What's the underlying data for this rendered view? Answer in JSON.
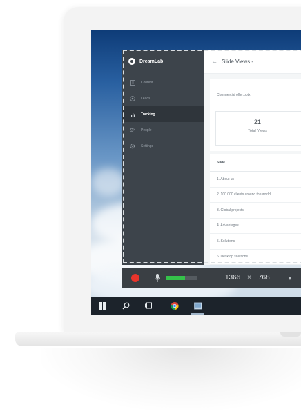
{
  "app": {
    "brand": "DreamLab",
    "nav": [
      {
        "label": "Content",
        "icon": "document-icon",
        "active": false
      },
      {
        "label": "Leads",
        "icon": "target-icon",
        "active": false
      },
      {
        "label": "Tracking",
        "icon": "chart-icon",
        "active": true
      },
      {
        "label": "People",
        "icon": "people-icon",
        "active": false
      },
      {
        "label": "Settings",
        "icon": "gear-icon",
        "active": false
      }
    ],
    "header": {
      "title": "Slide Views -"
    },
    "file_name": "Commercial offer.pptx",
    "stat": {
      "value": "21",
      "label": "Total Views"
    },
    "table": {
      "header": "Slide",
      "rows": [
        "1. About us",
        "2. 100 000 clients around the world",
        "3. Global projects",
        "4. Advantages",
        "5. Solutions",
        "6. Desktop solutions"
      ]
    }
  },
  "recorder": {
    "width": "1366",
    "times": "×",
    "height": "768",
    "level_percent": 60,
    "colors": {
      "record": "#e8342b",
      "level": "#35c24a"
    }
  },
  "taskbar": {
    "icons": [
      "windows-start-icon",
      "search-icon",
      "task-view-icon",
      "chrome-icon",
      "app-icon"
    ]
  }
}
